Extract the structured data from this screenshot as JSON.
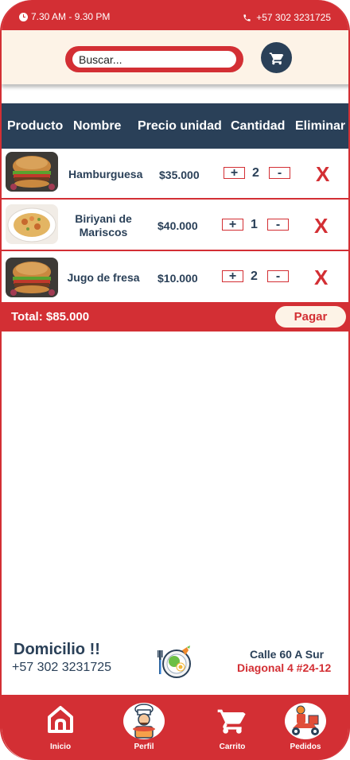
{
  "status_bar": {
    "hours": "7.30 AM - 9.30 PM",
    "phone": "+57 302 3231725"
  },
  "search": {
    "placeholder": "Buscar..."
  },
  "table": {
    "headers": [
      "Producto",
      "Nombre",
      "Precio unidad",
      "Cantidad",
      "Eliminar"
    ],
    "rows": [
      {
        "name": "Hamburguesa",
        "price": "$35.000",
        "qty": "2",
        "plus": "+",
        "minus": "-",
        "delete": "X",
        "image": "burger-image"
      },
      {
        "name": "Biriyani de Mariscos",
        "price": "$40.000",
        "qty": "1",
        "plus": "+",
        "minus": "-",
        "delete": "X",
        "image": "biriyani-image"
      },
      {
        "name": "Jugo de fresa",
        "price": "$10.000",
        "qty": "2",
        "plus": "+",
        "minus": "-",
        "delete": "X",
        "image": "burger-image"
      }
    ]
  },
  "total": {
    "label": "Total: $85.000",
    "pay_button": "Pagar"
  },
  "delivery": {
    "title": "Domicilio !!",
    "phone": "+57 302 3231725",
    "address_line1": "Calle 60 A Sur",
    "address_line2": "Diagonal 4  #24-12"
  },
  "nav": [
    {
      "label": "Inicio",
      "icon": "home-icon"
    },
    {
      "label": "Perfil",
      "icon": "chef-icon"
    },
    {
      "label": "Carrito",
      "icon": "cart-icon"
    },
    {
      "label": "Pedidos",
      "icon": "delivery-icon"
    }
  ],
  "colors": {
    "primary_red": "#d32f34",
    "navy": "#2a4058",
    "cream": "#fdf3e7"
  }
}
